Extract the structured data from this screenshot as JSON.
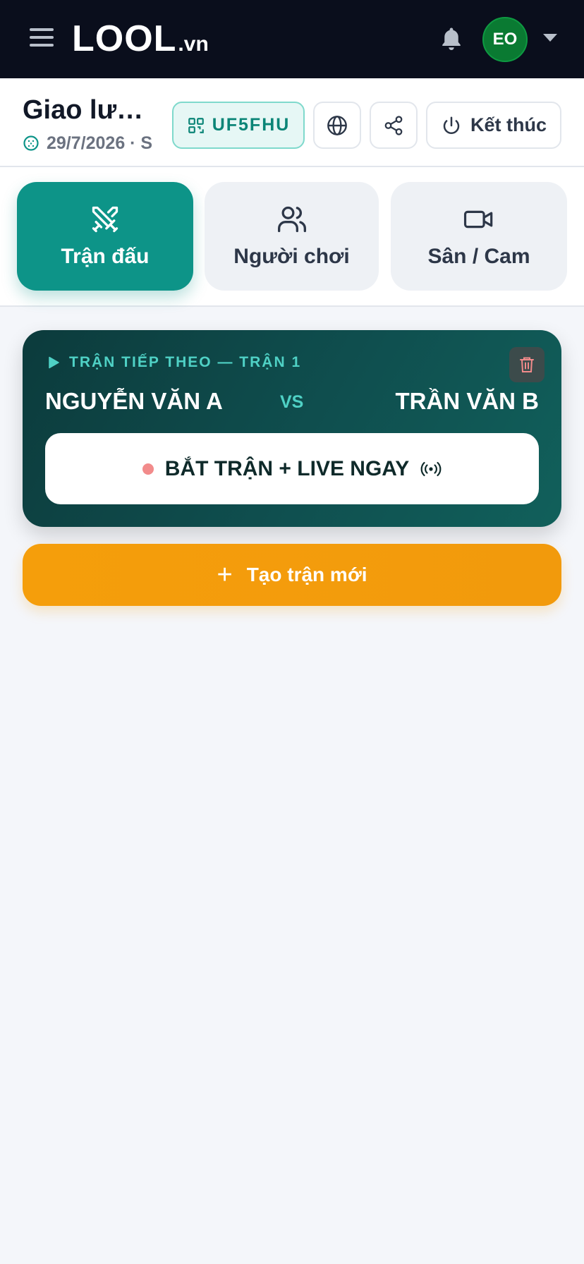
{
  "header": {
    "logo_text": "LOOL",
    "logo_suffix": ".vn",
    "avatar_initials": "EO",
    "icons": [
      "menu-icon",
      "bell-icon",
      "chevron-down-icon"
    ]
  },
  "session": {
    "title": "Giao lưu...",
    "meta": "29/7/2026 · S",
    "code": "UF5FHU",
    "end_label": "Kết thúc",
    "icons": [
      "ball-icon",
      "qr-code-icon",
      "globe-icon",
      "share-icon",
      "power-icon"
    ]
  },
  "tabs": [
    {
      "label": "Trận đấu",
      "icon": "crossed-swords-icon",
      "active": true
    },
    {
      "label": "Người chơi",
      "icon": "users-icon",
      "active": false
    },
    {
      "label": "Sân / Cam",
      "icon": "video-camera-icon",
      "active": false
    }
  ],
  "match": {
    "heading": "TRẬN TIẾP THEO — TRẬN 1",
    "player1": "NGUYỄN VĂN A",
    "vs": "VS",
    "player2": "TRẦN VĂN B",
    "start_label": "BẮT TRẬN + LIVE NGAY",
    "icons": [
      "play-icon",
      "trash-icon",
      "broadcast-icon"
    ]
  },
  "create": {
    "label": "Tạo trận mới",
    "icon": "plus-icon"
  },
  "colors": {
    "nav_bg": "#0a0e1c",
    "accent": "#0d9488",
    "accent_light": "#4fd1c5",
    "card_bg": "#0f4f4f",
    "create_bg": "#f59e0b",
    "avatar_bg": "#0a7a32",
    "page_bg": "#f4f6fa"
  }
}
